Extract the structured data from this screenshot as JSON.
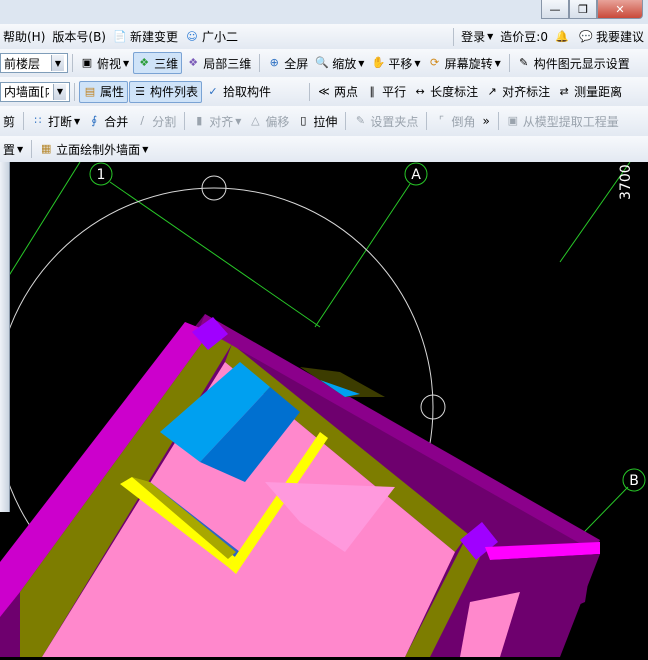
{
  "menubar": {
    "help": "帮助(H)",
    "version": "版本号(B)",
    "new_change": "新建变更",
    "assistant": "广小二",
    "login": "登录",
    "cost_beans": "造价豆:0",
    "suggest": "我要建议"
  },
  "toolbar2": {
    "floor_select": "前楼层",
    "top_view": "俯视",
    "view_3d": "三维",
    "partial_3d": "局部三维",
    "fullscreen": "全屏",
    "zoom": "缩放",
    "pan": "平移",
    "rotate": "屏幕旋转",
    "display_settings": "构件图元显示设置"
  },
  "toolbar3": {
    "wall_select": "内墙面[内",
    "properties": "属性",
    "component_list": "构件列表",
    "pick_component": "拾取构件",
    "two_points": "两点",
    "parallel": "平行",
    "length_dim": "长度标注",
    "align_dim": "对齐标注",
    "measure": "测量距离"
  },
  "toolbar4": {
    "cut": "剪",
    "break": "打断",
    "merge": "合并",
    "split": "分割",
    "align": "对齐",
    "offset": "偏移",
    "stretch": "拉伸",
    "set_pivot": "设置夹点",
    "chamfer": "倒角",
    "extract": "从模型提取工程量"
  },
  "toolbar5": {
    "settings": "置",
    "draw_elevation_wall": "立面绘制外墙面"
  },
  "viewport": {
    "axis_1": "1",
    "axis_A": "A",
    "axis_B": "B",
    "dimension": "3700"
  },
  "colors": {
    "magenta_face": "#ff00ff",
    "pink_face": "#ff88cc",
    "olive_face": "#8b8b00",
    "purple_top": "#6e006e",
    "cyan_face": "#00a0f0",
    "yellow_edge": "#ffff00",
    "axis_green": "#28c828"
  }
}
